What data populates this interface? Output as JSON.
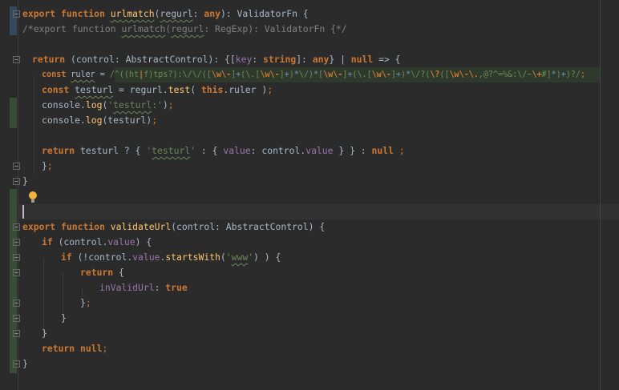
{
  "editor": {
    "lines": [
      {
        "indent": 0,
        "tokens": [
          [
            "kw",
            "export "
          ],
          [
            "kw",
            "function "
          ],
          [
            "fn wavy",
            "urlmatch"
          ],
          [
            "",
            "("
          ],
          [
            "wavy",
            "regurl"
          ],
          [
            "",
            ": "
          ],
          [
            "kw",
            "any"
          ],
          [
            "",
            "): ValidatorFn {"
          ]
        ]
      },
      {
        "indent": 0,
        "tokens": [
          [
            "cm",
            "/*export function "
          ],
          [
            "cm wavy",
            "urlmatch"
          ],
          [
            "cm",
            "("
          ],
          [
            "cm wavy",
            "regurl"
          ],
          [
            "cm",
            ": RegExp): ValidatorFn {*/"
          ]
        ]
      },
      {
        "indent": 0,
        "tokens": []
      },
      {
        "indent": 12,
        "tokens": [
          [
            "kw",
            "return "
          ],
          [
            "",
            "(control: AbstractControl): {["
          ],
          [
            "prop",
            "key"
          ],
          [
            "",
            ": "
          ],
          [
            "kw",
            "string"
          ],
          [
            "",
            "]: "
          ],
          [
            "kw",
            "any"
          ],
          [
            "",
            "} | "
          ],
          [
            "kw",
            "null"
          ],
          [
            "",
            " => {"
          ]
        ]
      },
      {
        "indent": 24,
        "tokens": [
          [
            "kw",
            "const "
          ],
          [
            "wavy",
            "ruler"
          ],
          [
            "",
            " = "
          ],
          [
            "rx",
            "/^(("
          ],
          [
            "rx",
            "ht"
          ],
          [
            "rxe",
            "|"
          ],
          [
            "rx",
            "f)tps?):"
          ],
          [
            "rx",
            "\\/\\/("
          ],
          [
            "rx",
            "["
          ],
          [
            "rxe",
            "\\w\\-"
          ],
          [
            "rx",
            "]"
          ],
          [
            "rxo",
            "+"
          ],
          [
            "rx",
            "(\\.["
          ],
          [
            "rxe",
            "\\w\\-"
          ],
          [
            "rx",
            "]"
          ],
          [
            "rxo",
            "+"
          ],
          [
            "rx",
            ")"
          ],
          [
            "rxo",
            "*"
          ],
          [
            "rx",
            "\\/)"
          ],
          [
            "rxo",
            "*"
          ],
          [
            "rx",
            "["
          ],
          [
            "rxe",
            "\\w\\-"
          ],
          [
            "rx",
            "]"
          ],
          [
            "rxo",
            "+"
          ],
          [
            "rx",
            "(\\.["
          ],
          [
            "rxe",
            "\\w\\-"
          ],
          [
            "rx",
            "]"
          ],
          [
            "rxo",
            "+"
          ],
          [
            "rx",
            ")"
          ],
          [
            "rxo",
            "*"
          ],
          [
            "rx",
            "\\/?("
          ],
          [
            "rxe",
            "\\?"
          ],
          [
            "rx",
            "(["
          ],
          [
            "rxe",
            "\\w\\-\\."
          ],
          [
            "rx",
            ",@?^=%&:\\/~"
          ],
          [
            "rxe",
            "\\+"
          ],
          [
            "rx",
            "#]"
          ],
          [
            "rxo",
            "*"
          ],
          [
            "rx",
            ")"
          ],
          [
            "rxo",
            "+"
          ],
          [
            "rx",
            ")?/"
          ],
          [
            "semi",
            ";"
          ]
        ]
      },
      {
        "indent": 24,
        "tokens": [
          [
            "kw",
            "const "
          ],
          [
            "wavy",
            "testurl"
          ],
          [
            "",
            " = regurl."
          ],
          [
            "fn",
            "test"
          ],
          [
            "",
            "( "
          ],
          [
            "kw",
            "this"
          ],
          [
            "",
            ".ruler )"
          ],
          [
            "semi",
            ";"
          ]
        ]
      },
      {
        "indent": 24,
        "tokens": [
          [
            "",
            "console."
          ],
          [
            "fn",
            "log"
          ],
          [
            "",
            "("
          ],
          [
            "str",
            "'"
          ],
          [
            "str wavy",
            "testurl"
          ],
          [
            "str",
            ":'"
          ],
          [
            "",
            ")"
          ],
          [
            "semi",
            ";"
          ]
        ]
      },
      {
        "indent": 24,
        "tokens": [
          [
            "",
            "console."
          ],
          [
            "fn",
            "log"
          ],
          [
            "",
            "(testurl)"
          ],
          [
            "semi",
            ";"
          ]
        ]
      },
      {
        "indent": 0,
        "tokens": []
      },
      {
        "indent": 24,
        "tokens": [
          [
            "kw",
            "return "
          ],
          [
            "",
            "testurl ? { "
          ],
          [
            "str",
            "'"
          ],
          [
            "str wavy",
            "testurl"
          ],
          [
            "str",
            "'"
          ],
          [
            "",
            " : { "
          ],
          [
            "prop",
            "value"
          ],
          [
            "",
            ": control."
          ],
          [
            "prop",
            "value"
          ],
          [
            "",
            " } } : "
          ],
          [
            "kw",
            "null"
          ],
          [
            "semi",
            " ;"
          ]
        ]
      },
      {
        "indent": 24,
        "tokens": [
          [
            "",
            "}"
          ],
          [
            "semi",
            ";"
          ]
        ]
      },
      {
        "indent": 0,
        "tokens": [
          [
            "",
            "}"
          ]
        ]
      },
      {
        "indent": 0,
        "tokens": []
      },
      {
        "indent": 0,
        "tokens": []
      },
      {
        "indent": 0,
        "tokens": [
          [
            "kw",
            "export "
          ],
          [
            "kw",
            "function "
          ],
          [
            "fn",
            "validateUrl"
          ],
          [
            "",
            "(control: AbstractControl) {"
          ]
        ]
      },
      {
        "indent": 24,
        "tokens": [
          [
            "kw",
            "if "
          ],
          [
            "",
            "(control."
          ],
          [
            "prop",
            "value"
          ],
          [
            "",
            ") {"
          ]
        ]
      },
      {
        "indent": 48,
        "tokens": [
          [
            "kw",
            "if "
          ],
          [
            "",
            "(!control."
          ],
          [
            "prop",
            "value"
          ],
          [
            "",
            "."
          ],
          [
            "fn",
            "startsWith"
          ],
          [
            "",
            "("
          ],
          [
            "str",
            "'"
          ],
          [
            "str wavy",
            "www"
          ],
          [
            "str",
            "'"
          ],
          [
            "",
            ") ) {"
          ]
        ]
      },
      {
        "indent": 72,
        "tokens": [
          [
            "kw",
            "return "
          ],
          [
            "",
            "{"
          ]
        ]
      },
      {
        "indent": 96,
        "tokens": [
          [
            "prop",
            "inValidUrl"
          ],
          [
            "",
            ": "
          ],
          [
            "kw",
            "true"
          ]
        ]
      },
      {
        "indent": 72,
        "tokens": [
          [
            "",
            "}"
          ],
          [
            "semi",
            ";"
          ]
        ]
      },
      {
        "indent": 48,
        "tokens": [
          [
            "",
            "}"
          ]
        ]
      },
      {
        "indent": 24,
        "tokens": [
          [
            "",
            "}"
          ]
        ]
      },
      {
        "indent": 24,
        "tokens": [
          [
            "kw",
            "return "
          ],
          [
            "kw",
            "null"
          ],
          [
            "semi",
            ";"
          ]
        ]
      },
      {
        "indent": 0,
        "tokens": [
          [
            "",
            "}"
          ]
        ]
      }
    ],
    "folds": [
      0,
      3,
      10,
      11,
      14,
      15,
      16,
      17,
      19,
      20,
      21,
      23
    ],
    "colors": {
      "background": "#2b2b2b",
      "keyword": "#cc7832",
      "function": "#ffc66d",
      "string": "#6a8759",
      "property": "#9876aa"
    }
  }
}
